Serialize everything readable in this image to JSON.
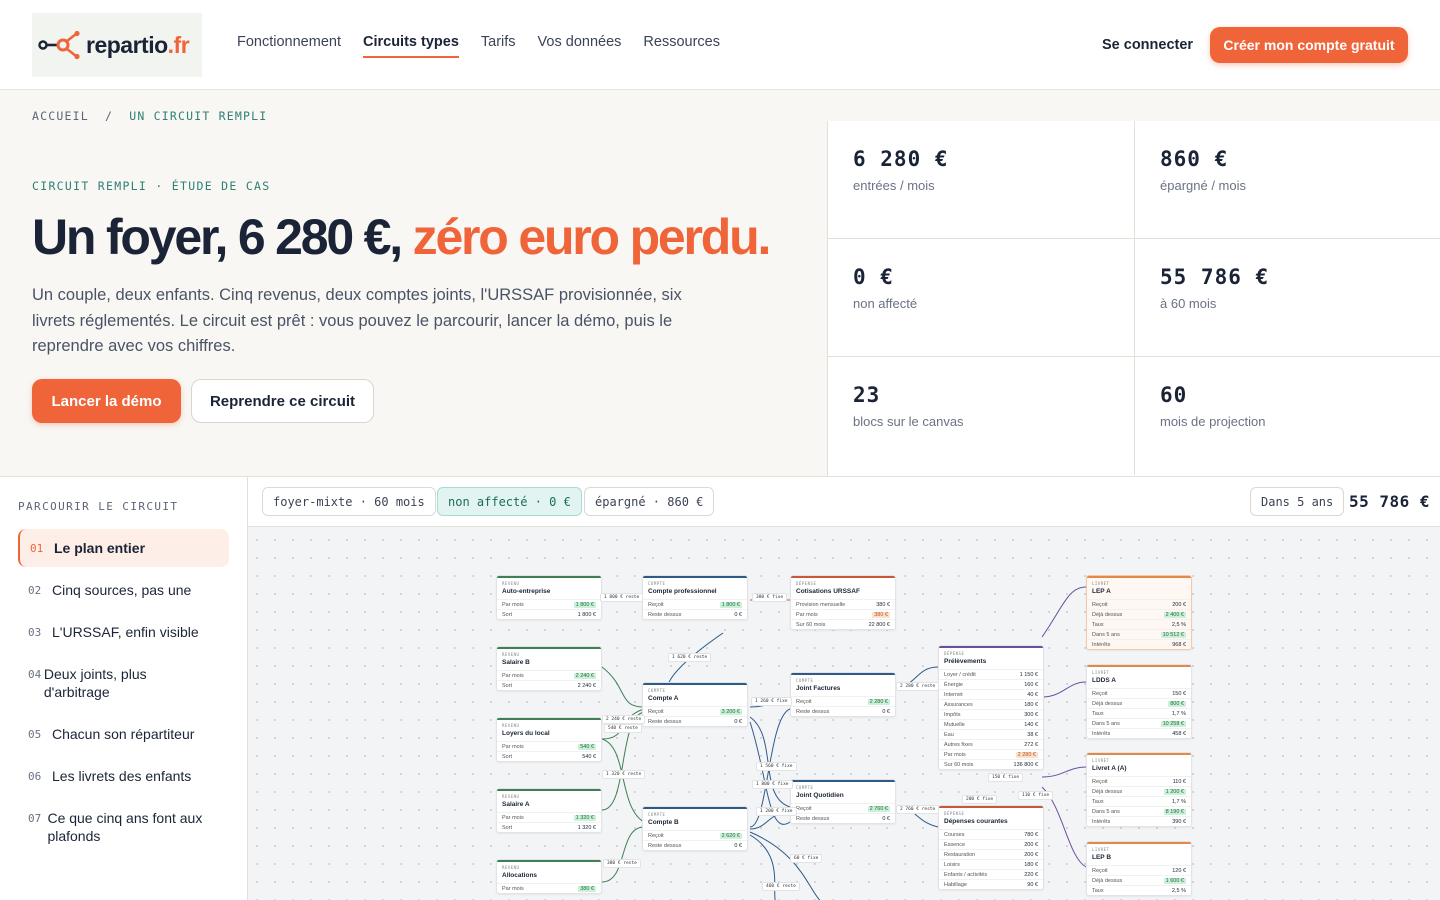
{
  "brand": {
    "name": "repartio",
    "tld": ".fr"
  },
  "nav": {
    "items": [
      "Fonctionnement",
      "Circuits types",
      "Tarifs",
      "Vos données",
      "Ressources"
    ],
    "login": "Se connecter",
    "cta": "Créer mon compte gratuit"
  },
  "breadcrumb": {
    "home": "ACCUEIL",
    "sep": "/",
    "current": "UN CIRCUIT REMPLI"
  },
  "hero": {
    "eyebrow": "CIRCUIT REMPLI · ÉTUDE DE CAS",
    "title_main": "Un foyer, 6 280 €, ",
    "title_highlight": "zéro euro perdu.",
    "lead": "Un couple, deux enfants. Cinq revenus, deux comptes joints, l'URSSAF provisionnée, six livrets réglementés. Le circuit est prêt : vous pouvez le parcourir, lancer la démo, puis le reprendre avec vos chiffres.",
    "primary_button": "Lancer la démo",
    "secondary_button": "Reprendre ce circuit"
  },
  "stats": [
    {
      "value": "6 280 €",
      "label": "entrées / mois"
    },
    {
      "value": "860 €",
      "label": "épargné / mois"
    },
    {
      "value": "0 €",
      "label": "non affecté"
    },
    {
      "value": "55 786 €",
      "label": "à 60 mois"
    },
    {
      "value": "23",
      "label": "blocs sur le canvas"
    },
    {
      "value": "60",
      "label": "mois de projection"
    }
  ],
  "rail": {
    "title": "PARCOURIR LE CIRCUIT",
    "steps": [
      {
        "num": "01",
        "label": "Le plan entier"
      },
      {
        "num": "02",
        "label": "Cinq sources, pas une"
      },
      {
        "num": "03",
        "label": "L'URSSAF, enfin visible"
      },
      {
        "num": "04",
        "label": "Deux joints, plus d'arbitrage"
      },
      {
        "num": "05",
        "label": "Chacun son répartiteur"
      },
      {
        "num": "06",
        "label": "Les livrets des enfants"
      },
      {
        "num": "07",
        "label": "Ce que cinq ans font aux plafonds"
      }
    ]
  },
  "canvas_bar": {
    "chip_circuit": "foyer-mixte · 60 mois",
    "chip_unassigned": "non affecté · 0 €",
    "chip_saved": "épargné · 860 €",
    "projection_label": "Dans 5 ans",
    "projection_value": "55 786 €"
  },
  "colors": {
    "accent": "#f0643a",
    "ink": "#1b2436",
    "teal": "#2f7f74",
    "income": "#3f7f55",
    "account": "#2e5a8a",
    "expense": "#c9583a",
    "savings": "#e2894a",
    "expense_purple": "#6a4fa0"
  },
  "nodes": [
    {
      "kind": "REVENU",
      "title": "Auto-entreprise",
      "color": "#3f7f55",
      "rows": [
        [
          "Par mois",
          "1 800 €",
          "g"
        ],
        [
          "Sort",
          "1 800 €",
          ""
        ]
      ]
    },
    {
      "kind": "REVENU",
      "title": "Salaire B",
      "color": "#3f7f55",
      "rows": [
        [
          "Par mois",
          "2 240 €",
          "g"
        ],
        [
          "Sort",
          "2 240 €",
          ""
        ]
      ]
    },
    {
      "kind": "REVENU",
      "title": "Loyers du local",
      "color": "#3f7f55",
      "rows": [
        [
          "Par mois",
          "540 €",
          "g"
        ],
        [
          "Sort",
          "540 €",
          ""
        ]
      ]
    },
    {
      "kind": "REVENU",
      "title": "Salaire A",
      "color": "#3f7f55",
      "rows": [
        [
          "Par mois",
          "1 320 €",
          "g"
        ],
        [
          "Sort",
          "1 320 €",
          ""
        ]
      ]
    },
    {
      "kind": "REVENU",
      "title": "Allocations",
      "color": "#3f7f55",
      "rows": [
        [
          "Par mois",
          "380 €",
          "g"
        ]
      ]
    },
    {
      "kind": "COMPTE",
      "title": "Compte professionnel",
      "color": "#2e5a8a",
      "rows": [
        [
          "Reçoit",
          "1 800 €",
          "g"
        ],
        [
          "Reste dessus",
          "0 €",
          ""
        ]
      ]
    },
    {
      "kind": "COMPTE",
      "title": "Compte A",
      "color": "#2e5a8a",
      "rows": [
        [
          "Reçoit",
          "3 200 €",
          "g"
        ],
        [
          "Reste dessus",
          "0 €",
          ""
        ]
      ]
    },
    {
      "kind": "COMPTE",
      "title": "Compte B",
      "color": "#2e5a8a",
      "rows": [
        [
          "Reçoit",
          "2 620 €",
          "g"
        ],
        [
          "Reste dessus",
          "0 €",
          ""
        ]
      ]
    },
    {
      "kind": "DÉPENSE",
      "title": "Cotisations URSSAF",
      "color": "#c9583a",
      "rows": [
        [
          "Provision mensuelle",
          "380 €",
          ""
        ],
        [
          "Par mois",
          "380 €",
          "o"
        ],
        [
          "Sur 60 mois",
          "22 800 €",
          ""
        ]
      ]
    },
    {
      "kind": "COMPTE",
      "title": "Joint Factures",
      "color": "#2e5a8a",
      "rows": [
        [
          "Reçoit",
          "2 280 €",
          "g"
        ],
        [
          "Reste dessus",
          "0 €",
          ""
        ]
      ]
    },
    {
      "kind": "COMPTE",
      "title": "Joint Quotidien",
      "color": "#2e5a8a",
      "rows": [
        [
          "Reçoit",
          "2 760 €",
          "g"
        ],
        [
          "Reste dessus",
          "0 €",
          ""
        ]
      ]
    },
    {
      "kind": "DÉPENSE",
      "title": "Prélèvements",
      "color": "#6a4fa0",
      "rows": [
        [
          "Loyer / crédit",
          "1 150 €",
          ""
        ],
        [
          "Énergie",
          "160 €",
          ""
        ],
        [
          "Internet",
          "40 €",
          ""
        ],
        [
          "Assurances",
          "180 €",
          ""
        ],
        [
          "Impôts",
          "300 €",
          ""
        ],
        [
          "Mutuelle",
          "140 €",
          ""
        ],
        [
          "Eau",
          "38 €",
          ""
        ],
        [
          "Autres fixes",
          "272 €",
          ""
        ],
        [
          "Par mois",
          "2 280 €",
          "o"
        ],
        [
          "Sur 60 mois",
          "136 800 €",
          ""
        ]
      ]
    },
    {
      "kind": "DÉPENSE",
      "title": "Dépenses courantes",
      "color": "#c9583a",
      "rows": [
        [
          "Courses",
          "780 €",
          ""
        ],
        [
          "Essence",
          "200 €",
          ""
        ],
        [
          "Restauration",
          "200 €",
          ""
        ],
        [
          "Loisirs",
          "180 €",
          ""
        ],
        [
          "Enfants / activités",
          "220 €",
          ""
        ],
        [
          "Habillage",
          "90 €",
          ""
        ]
      ]
    },
    {
      "kind": "LIVRET",
      "title": "LEP A",
      "color": "#e2894a",
      "sav": true,
      "rows": [
        [
          "Reçoit",
          "200 €",
          ""
        ],
        [
          "Déjà dessus",
          "2 400 €",
          "g"
        ],
        [
          "Taux",
          "2,5 %",
          ""
        ],
        [
          "Dans 5 ans",
          "10 512 €",
          "g"
        ],
        [
          "Intérêts",
          "968 €",
          ""
        ]
      ]
    },
    {
      "kind": "LIVRET",
      "title": "LDDS A",
      "color": "#e2894a",
      "rows": [
        [
          "Reçoit",
          "150 €",
          ""
        ],
        [
          "Déjà dessus",
          "800 €",
          "g"
        ],
        [
          "Taux",
          "1,7 %",
          ""
        ],
        [
          "Dans 5 ans",
          "10 258 €",
          "g"
        ],
        [
          "Intérêts",
          "458 €",
          ""
        ]
      ]
    },
    {
      "kind": "LIVRET",
      "title": "Livret A (A)",
      "color": "#e2894a",
      "rows": [
        [
          "Reçoit",
          "110 €",
          ""
        ],
        [
          "Déjà dessus",
          "1 200 €",
          "g"
        ],
        [
          "Taux",
          "1,7 %",
          ""
        ],
        [
          "Dans 5 ans",
          "8 190 €",
          "g"
        ],
        [
          "Intérêts",
          "390 €",
          ""
        ]
      ]
    },
    {
      "kind": "LIVRET",
      "title": "LEP B",
      "color": "#e2894a",
      "rows": [
        [
          "Reçoit",
          "120 €",
          ""
        ],
        [
          "Déjà dessus",
          "1 600 €",
          "g"
        ],
        [
          "Taux",
          "2,5 %",
          ""
        ]
      ]
    }
  ],
  "edge_labels": [
    "1 800 € reste",
    "380 € fixe",
    "1 620 € reste",
    "1 260 € fixe",
    "2 280 € reste",
    "2 240 € reste",
    "540 € reste",
    "1 560 € fixe",
    "1 320 € reste",
    "1 800 € fixe",
    "2 760 € reste",
    "1 200 € fixe",
    "150 € fixe",
    "200 € fixe",
    "110 € fixe",
    "380 € reste",
    "60 € fixe",
    "460 € reste"
  ]
}
